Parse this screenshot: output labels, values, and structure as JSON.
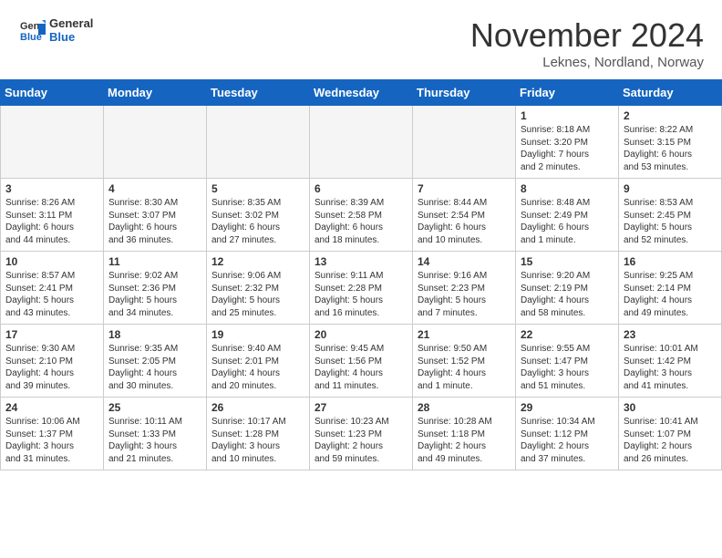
{
  "header": {
    "logo_line1": "General",
    "logo_line2": "Blue",
    "title": "November 2024",
    "subtitle": "Leknes, Nordland, Norway"
  },
  "days_of_week": [
    "Sunday",
    "Monday",
    "Tuesday",
    "Wednesday",
    "Thursday",
    "Friday",
    "Saturday"
  ],
  "weeks": [
    [
      {
        "day": "",
        "info": ""
      },
      {
        "day": "",
        "info": ""
      },
      {
        "day": "",
        "info": ""
      },
      {
        "day": "",
        "info": ""
      },
      {
        "day": "",
        "info": ""
      },
      {
        "day": "1",
        "info": "Sunrise: 8:18 AM\nSunset: 3:20 PM\nDaylight: 7 hours\nand 2 minutes."
      },
      {
        "day": "2",
        "info": "Sunrise: 8:22 AM\nSunset: 3:15 PM\nDaylight: 6 hours\nand 53 minutes."
      }
    ],
    [
      {
        "day": "3",
        "info": "Sunrise: 8:26 AM\nSunset: 3:11 PM\nDaylight: 6 hours\nand 44 minutes."
      },
      {
        "day": "4",
        "info": "Sunrise: 8:30 AM\nSunset: 3:07 PM\nDaylight: 6 hours\nand 36 minutes."
      },
      {
        "day": "5",
        "info": "Sunrise: 8:35 AM\nSunset: 3:02 PM\nDaylight: 6 hours\nand 27 minutes."
      },
      {
        "day": "6",
        "info": "Sunrise: 8:39 AM\nSunset: 2:58 PM\nDaylight: 6 hours\nand 18 minutes."
      },
      {
        "day": "7",
        "info": "Sunrise: 8:44 AM\nSunset: 2:54 PM\nDaylight: 6 hours\nand 10 minutes."
      },
      {
        "day": "8",
        "info": "Sunrise: 8:48 AM\nSunset: 2:49 PM\nDaylight: 6 hours\nand 1 minute."
      },
      {
        "day": "9",
        "info": "Sunrise: 8:53 AM\nSunset: 2:45 PM\nDaylight: 5 hours\nand 52 minutes."
      }
    ],
    [
      {
        "day": "10",
        "info": "Sunrise: 8:57 AM\nSunset: 2:41 PM\nDaylight: 5 hours\nand 43 minutes."
      },
      {
        "day": "11",
        "info": "Sunrise: 9:02 AM\nSunset: 2:36 PM\nDaylight: 5 hours\nand 34 minutes."
      },
      {
        "day": "12",
        "info": "Sunrise: 9:06 AM\nSunset: 2:32 PM\nDaylight: 5 hours\nand 25 minutes."
      },
      {
        "day": "13",
        "info": "Sunrise: 9:11 AM\nSunset: 2:28 PM\nDaylight: 5 hours\nand 16 minutes."
      },
      {
        "day": "14",
        "info": "Sunrise: 9:16 AM\nSunset: 2:23 PM\nDaylight: 5 hours\nand 7 minutes."
      },
      {
        "day": "15",
        "info": "Sunrise: 9:20 AM\nSunset: 2:19 PM\nDaylight: 4 hours\nand 58 minutes."
      },
      {
        "day": "16",
        "info": "Sunrise: 9:25 AM\nSunset: 2:14 PM\nDaylight: 4 hours\nand 49 minutes."
      }
    ],
    [
      {
        "day": "17",
        "info": "Sunrise: 9:30 AM\nSunset: 2:10 PM\nDaylight: 4 hours\nand 39 minutes."
      },
      {
        "day": "18",
        "info": "Sunrise: 9:35 AM\nSunset: 2:05 PM\nDaylight: 4 hours\nand 30 minutes."
      },
      {
        "day": "19",
        "info": "Sunrise: 9:40 AM\nSunset: 2:01 PM\nDaylight: 4 hours\nand 20 minutes."
      },
      {
        "day": "20",
        "info": "Sunrise: 9:45 AM\nSunset: 1:56 PM\nDaylight: 4 hours\nand 11 minutes."
      },
      {
        "day": "21",
        "info": "Sunrise: 9:50 AM\nSunset: 1:52 PM\nDaylight: 4 hours\nand 1 minute."
      },
      {
        "day": "22",
        "info": "Sunrise: 9:55 AM\nSunset: 1:47 PM\nDaylight: 3 hours\nand 51 minutes."
      },
      {
        "day": "23",
        "info": "Sunrise: 10:01 AM\nSunset: 1:42 PM\nDaylight: 3 hours\nand 41 minutes."
      }
    ],
    [
      {
        "day": "24",
        "info": "Sunrise: 10:06 AM\nSunset: 1:37 PM\nDaylight: 3 hours\nand 31 minutes."
      },
      {
        "day": "25",
        "info": "Sunrise: 10:11 AM\nSunset: 1:33 PM\nDaylight: 3 hours\nand 21 minutes."
      },
      {
        "day": "26",
        "info": "Sunrise: 10:17 AM\nSunset: 1:28 PM\nDaylight: 3 hours\nand 10 minutes."
      },
      {
        "day": "27",
        "info": "Sunrise: 10:23 AM\nSunset: 1:23 PM\nDaylight: 2 hours\nand 59 minutes."
      },
      {
        "day": "28",
        "info": "Sunrise: 10:28 AM\nSunset: 1:18 PM\nDaylight: 2 hours\nand 49 minutes."
      },
      {
        "day": "29",
        "info": "Sunrise: 10:34 AM\nSunset: 1:12 PM\nDaylight: 2 hours\nand 37 minutes."
      },
      {
        "day": "30",
        "info": "Sunrise: 10:41 AM\nSunset: 1:07 PM\nDaylight: 2 hours\nand 26 minutes."
      }
    ]
  ]
}
